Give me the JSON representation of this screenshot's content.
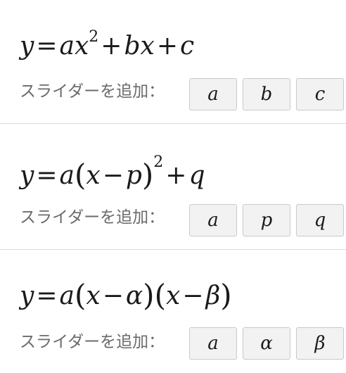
{
  "panels": [
    {
      "formula": {
        "y": "y",
        "eq": "=",
        "a": "a",
        "x": "x",
        "exp": "2",
        "plus1": "+",
        "b": "b",
        "x2": "x",
        "plus2": "+",
        "c": "c"
      },
      "slider_label": "スライダーを追加：",
      "buttons": [
        "a",
        "b",
        "c"
      ]
    },
    {
      "formula": {
        "y": "y",
        "eq": "=",
        "a": "a",
        "lparen": "(",
        "x": "x",
        "minus": "−",
        "p": "p",
        "rparen": ")",
        "exp": "2",
        "plus": "+",
        "q": "q"
      },
      "slider_label": "スライダーを追加：",
      "buttons": [
        "a",
        "p",
        "q"
      ]
    },
    {
      "formula": {
        "y": "y",
        "eq": "=",
        "a": "a",
        "lparen1": "(",
        "x1": "x",
        "minus1": "−",
        "alpha": "α",
        "rparen1": ")",
        "lparen2": "(",
        "x2": "x",
        "minus2": "−",
        "beta": "β",
        "rparen2": ")"
      },
      "slider_label": "スライダーを追加：",
      "buttons": [
        "a",
        "α",
        "β"
      ]
    }
  ]
}
